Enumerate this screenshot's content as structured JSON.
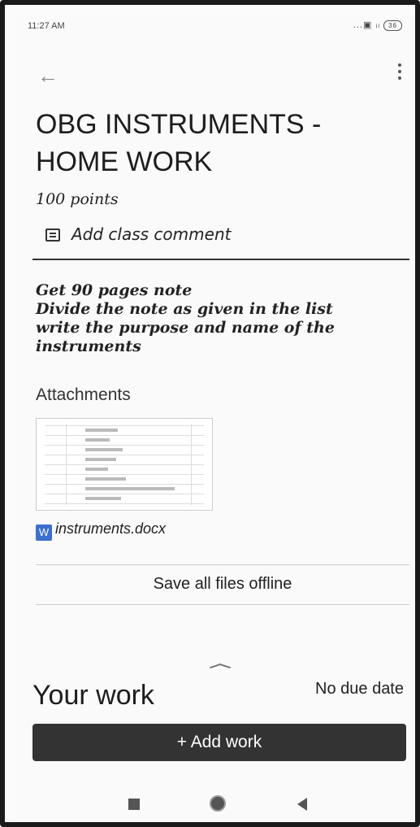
{
  "status_bar": {
    "time": "11:27 AM",
    "battery": "36",
    "signal": "...▣ ᵢₗ"
  },
  "assignment": {
    "title_line1": "OBG INSTRUMENTS -",
    "title_line2": "HOME WORK",
    "points": "100 points",
    "add_comment_label": "Add class comment",
    "description": [
      "Get 90 pages note",
      "Divide the note as given in the list",
      "write the purpose and name of the",
      "instruments"
    ]
  },
  "attachments": {
    "heading": "Attachments",
    "file_icon": "W",
    "file_name": "instruments.docx",
    "save_offline_label": "Save all files offline"
  },
  "your_work": {
    "heading": "Your work",
    "due": "No due date",
    "add_work_label": "+ Add work"
  },
  "icons": {
    "back": "arrow-left-icon",
    "more": "more-vert-icon",
    "comment": "comment-icon",
    "word": "word-file-icon"
  },
  "colors": {
    "add_work_bg": "#333333",
    "word_icon": "#3b6fd1"
  }
}
